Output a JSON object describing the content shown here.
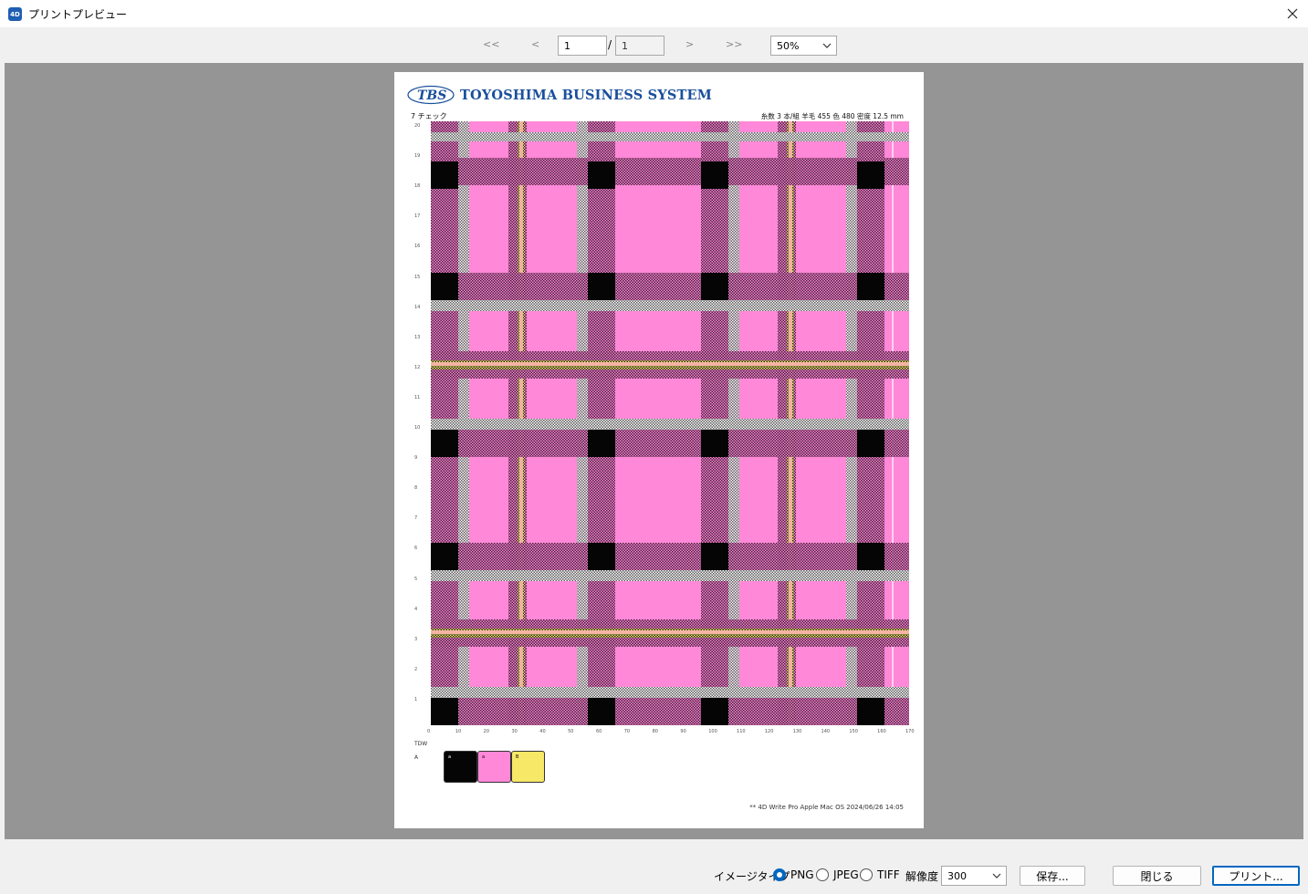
{
  "window": {
    "title": "プリントプレビュー",
    "icon_label": "4D"
  },
  "toolbar": {
    "first_label": "<<",
    "prev_label": "<",
    "current_page": "1",
    "separator": "/",
    "total_pages": "1",
    "next_label": ">",
    "last_label": ">>",
    "zoom": "50%"
  },
  "document": {
    "logo_text": "TBS",
    "company": "TOYOSHIMA BUSINESS SYSTEM",
    "header_left": "7 チェック",
    "header_right": "糸数 3 本/組 羊毛 455 色 480 密度 12.5 mm",
    "palette_title": "TDW",
    "palette_mark": "A",
    "swatches": [
      {
        "label": "a",
        "color": "#050505"
      },
      {
        "label": "a",
        "color": "#ff88d8"
      },
      {
        "label": "B",
        "color": "#f7e867"
      }
    ],
    "footer": "** 4D Write Pro Apple Mac OS 2024/06/26 14:05",
    "y_ticks": [
      "20",
      "19",
      "18",
      "17",
      "16",
      "15",
      "14",
      "13",
      "12",
      "11",
      "10",
      "9",
      "8",
      "7",
      "6",
      "5",
      "4",
      "3",
      "2",
      "1"
    ],
    "x_ticks": [
      "0",
      "10",
      "20",
      "30",
      "40",
      "50",
      "60",
      "70",
      "80",
      "90",
      "100",
      "110",
      "120",
      "130",
      "140",
      "150",
      "160",
      "170"
    ]
  },
  "colors": {
    "pink": "#ff88d8",
    "black": "#050505",
    "yellow": "#f7e867",
    "white_stripe": "#ffd7f0",
    "peach": "#f6b4a4",
    "preview_bg": "#959595",
    "accent": "#0067c0"
  },
  "bottom": {
    "image_type_label": "イメージタイプ",
    "png_label": "PNG",
    "jpeg_label": "JPEG",
    "tiff_label": "TIFF",
    "selected_type": "PNG",
    "resolution_label": "解像度",
    "resolution_value": "300",
    "save_label": "保存...",
    "close_label": "閉じる",
    "print_label": "プリント..."
  }
}
